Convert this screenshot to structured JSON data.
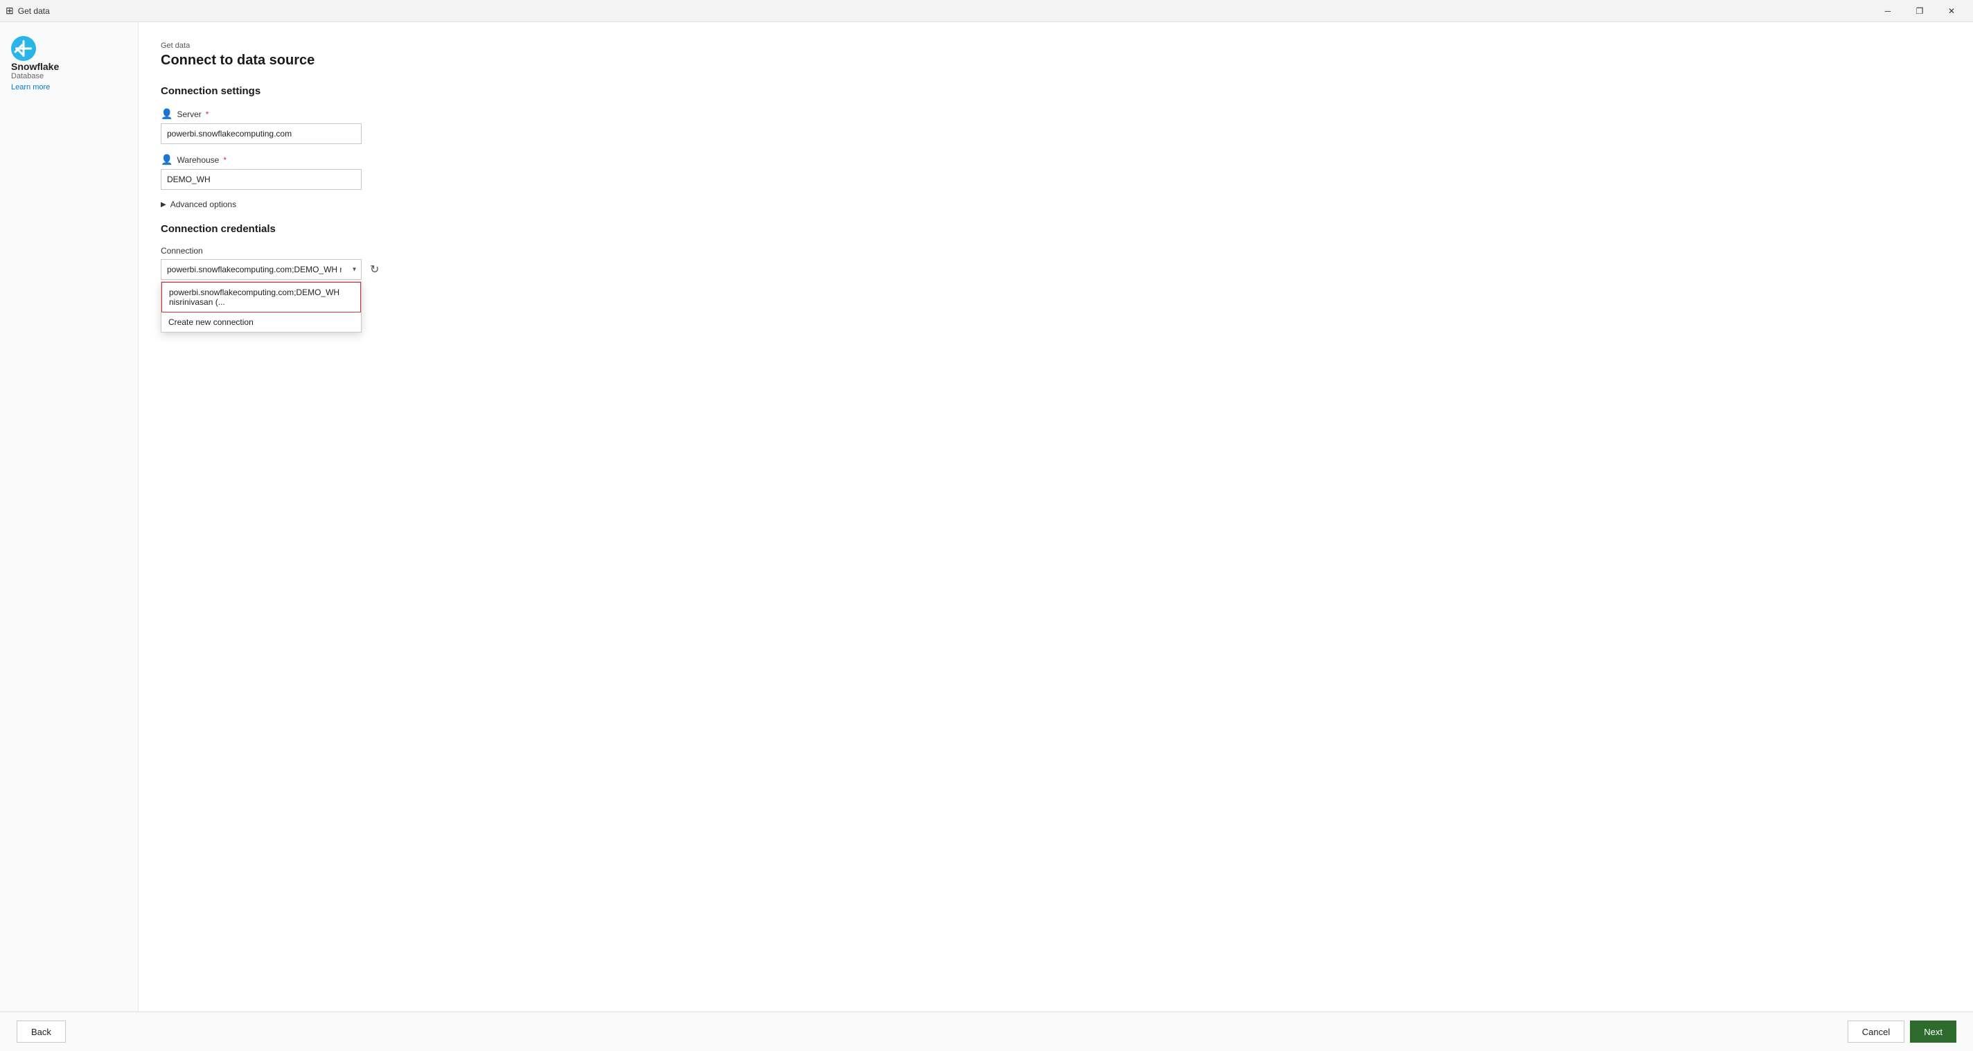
{
  "titlebar": {
    "icon": "⊞",
    "title": "Get data",
    "min_label": "─",
    "restore_label": "❐",
    "close_label": "✕"
  },
  "page": {
    "subtitle": "Get data",
    "title": "Connect to data source"
  },
  "sidebar": {
    "connector_name": "Snowflake",
    "connector_type": "Database",
    "learn_more": "Learn more"
  },
  "connection_settings": {
    "title": "Connection settings",
    "server_label": "Server",
    "server_required": "*",
    "server_value": "powerbi.snowflakecomputing.com",
    "warehouse_label": "Warehouse",
    "warehouse_required": "*",
    "warehouse_value": "DEMO_WH",
    "advanced_options": "Advanced options"
  },
  "connection_credentials": {
    "title": "Connection credentials",
    "connection_label": "Connection",
    "connection_value": "powerbi.snowflakecomputing.com;DEMO_WH nisriniva...",
    "dropdown_items": [
      {
        "label": "powerbi.snowflakecomputing.com;DEMO_WH nisrinivasan (...",
        "selected": true
      },
      {
        "label": "Create new connection",
        "selected": false
      }
    ]
  },
  "footer": {
    "back_label": "Back",
    "cancel_label": "Cancel",
    "next_label": "Next"
  }
}
